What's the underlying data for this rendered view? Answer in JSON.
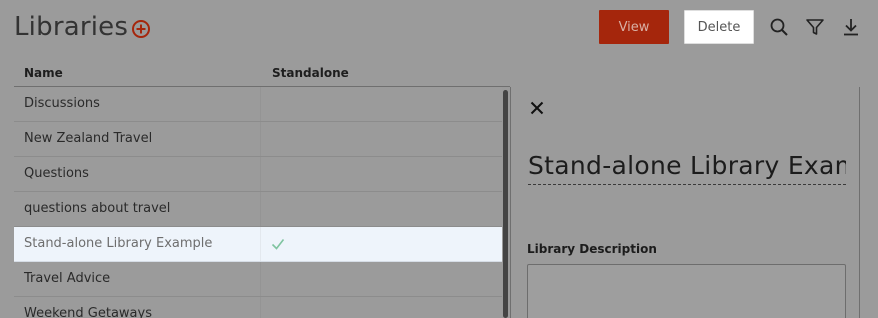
{
  "page": {
    "title": "Libraries"
  },
  "toolbar": {
    "view_label": "View",
    "delete_label": "Delete",
    "icons": [
      "add-circle-icon",
      "search-icon",
      "filter-icon",
      "download-icon"
    ]
  },
  "table": {
    "columns": [
      "Name",
      "Standalone"
    ],
    "rows": [
      {
        "name": "Discussions",
        "standalone": false,
        "selected": false
      },
      {
        "name": "New Zealand Travel",
        "standalone": false,
        "selected": false
      },
      {
        "name": "Questions",
        "standalone": false,
        "selected": false
      },
      {
        "name": "questions about travel",
        "standalone": false,
        "selected": false
      },
      {
        "name": "Stand-alone Library Example",
        "standalone": true,
        "selected": true
      },
      {
        "name": "Travel Advice",
        "standalone": false,
        "selected": false
      },
      {
        "name": "Weekend Getaways",
        "standalone": false,
        "selected": false
      }
    ]
  },
  "detail": {
    "title_value": "Stand-alone Library Example",
    "description_label": "Library Description",
    "description_value": ""
  },
  "colors": {
    "accent": "#a5260c",
    "overlay": "#9b9b9b",
    "selected_row": "#eef4fb",
    "check": "#7fc4a0"
  }
}
